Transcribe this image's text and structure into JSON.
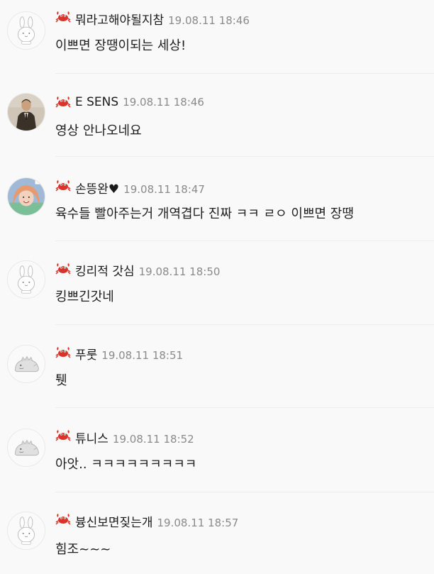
{
  "comments": [
    {
      "nickname": "뭐라고해야될지참",
      "time": "19.08.11 18:46",
      "text": "이쁘면 장땡이되는 세상!",
      "avatar": "bunny-default"
    },
    {
      "nickname": "E SENS",
      "time": "19.08.11 18:46",
      "text": "영상 안나오네요",
      "avatar": "photo-man"
    },
    {
      "nickname": "손뜽완♥",
      "time": "19.08.11 18:47",
      "text": "육수들 빨아주는거 개역겹다 진짜 ㅋㅋ ㄹㅇ 이쁘면 장땡",
      "avatar": "photo-woman"
    },
    {
      "nickname": "킹리적 갓심",
      "time": "19.08.11 18:50",
      "text": "킹쁘긴갓네",
      "avatar": "bunny-default"
    },
    {
      "nickname": "푸룻",
      "time": "19.08.11 18:51",
      "text": "퉷",
      "avatar": "dino-default"
    },
    {
      "nickname": "튜니스",
      "time": "19.08.11 18:52",
      "text": "아앗.. ㅋㅋㅋㅋㅋㅋㅋㅋㅋ",
      "avatar": "dino-default"
    },
    {
      "nickname": "븅신보면짖는개",
      "time": "19.08.11 18:57",
      "text": "힘조~~~",
      "avatar": "bunny-default"
    }
  ],
  "icons": {
    "badge": "crab-icon"
  },
  "colors": {
    "nickname": "#1a1a1a",
    "time": "#8a8a8a",
    "badge": "#d9342b"
  }
}
